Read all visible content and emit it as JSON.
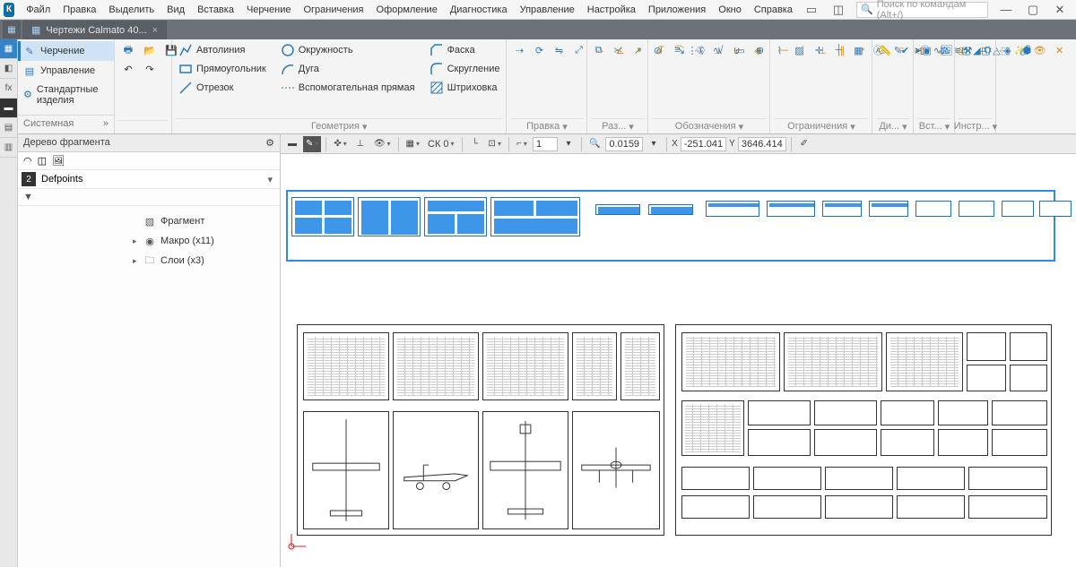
{
  "menu": [
    "Файл",
    "Правка",
    "Выделить",
    "Вид",
    "Вставка",
    "Черчение",
    "Ограничения",
    "Оформление",
    "Диагностика",
    "Управление",
    "Настройка",
    "Приложения",
    "Окно",
    "Справка"
  ],
  "search_placeholder": "Поиск по командам (Alt+/)",
  "tab": {
    "title": "Чертежи Calmato 40..."
  },
  "modes": {
    "drawing": "Черчение",
    "manage": "Управление",
    "std": "Стандартные изделия",
    "system": "Системная"
  },
  "ribbon": {
    "geom": {
      "title": "Геометрия",
      "autoline": "Автолиния",
      "rect": "Прямоугольник",
      "segment": "Отрезок",
      "circle": "Окружность",
      "arc": "Дуга",
      "helper": "Вспомогательная прямая",
      "chamfer": "Фаска",
      "fillet": "Скругление",
      "hatch": "Штриховка"
    },
    "groups": [
      "Правка",
      "Раз...",
      "Обозначения",
      "Ограничения",
      "Ди...",
      "Вст...",
      "Инстр..."
    ]
  },
  "tree": {
    "title": "Дерево фрагмента",
    "layer_num": "2",
    "layer_name": "Defpoints",
    "items": {
      "fragment": "Фрагмент",
      "macro": "Макро (x11)",
      "layers": "Слои (x3)"
    }
  },
  "viewbar": {
    "cs": "СК 0",
    "scale": "1",
    "step": "0.0159",
    "x": "-251.041",
    "y": "3646.414"
  }
}
